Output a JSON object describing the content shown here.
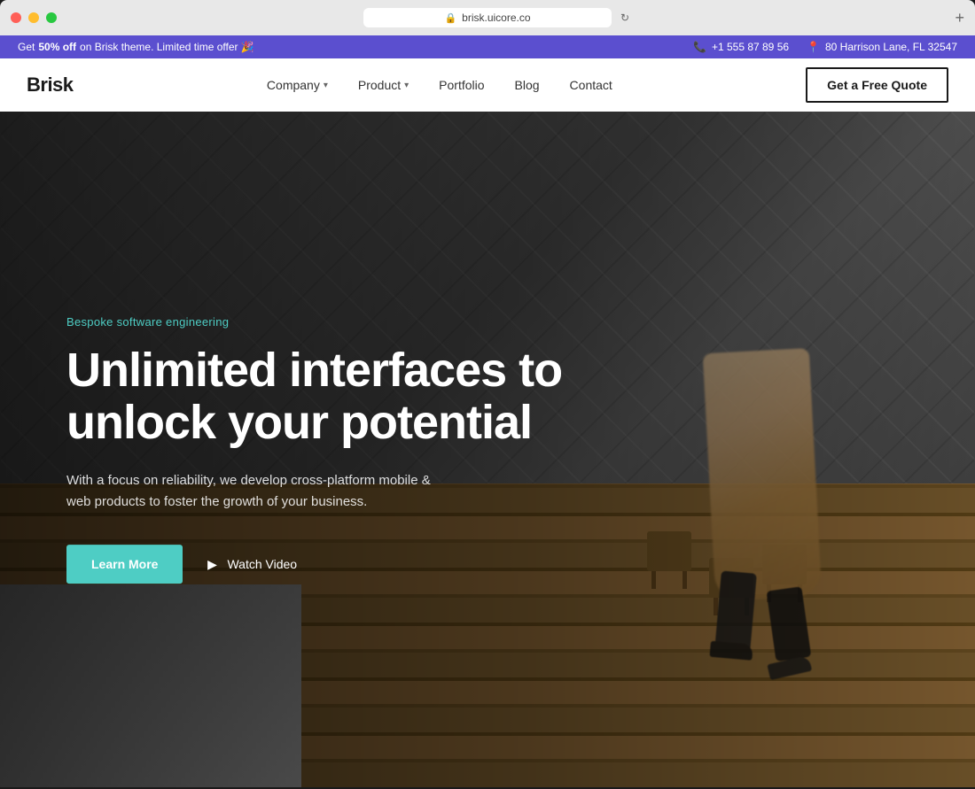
{
  "window": {
    "url": "brisk.uicore.co",
    "new_tab_icon": "+"
  },
  "promo_banner": {
    "text_prefix": "Get ",
    "text_bold": "50% off",
    "text_suffix": " on Brisk theme. Limited time offer 🎉",
    "phone_label": "+1 555 87 89 56",
    "address_label": "80 Harrison Lane, FL 32547"
  },
  "navbar": {
    "brand": "Brisk",
    "nav_items": [
      {
        "label": "Company",
        "has_dropdown": true
      },
      {
        "label": "Product",
        "has_dropdown": true
      },
      {
        "label": "Portfolio",
        "has_dropdown": false
      },
      {
        "label": "Blog",
        "has_dropdown": false
      },
      {
        "label": "Contact",
        "has_dropdown": false
      }
    ],
    "cta_label": "Get a Free Quote"
  },
  "hero": {
    "tagline": "Bespoke software engineering",
    "title_line1": "Unlimited interfaces to",
    "title_line2": "unlock your potential",
    "subtitle": "With a focus on reliability, we develop cross-platform mobile & web products to foster the growth of your business.",
    "btn_learn_more": "Learn More",
    "btn_watch_video": "Watch Video"
  }
}
